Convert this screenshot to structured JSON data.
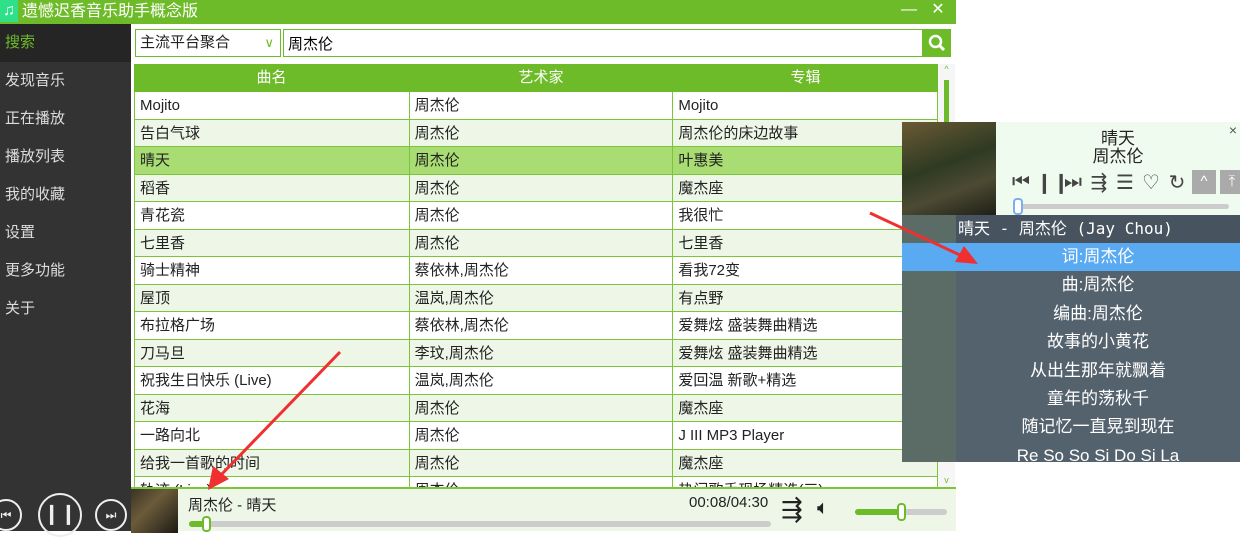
{
  "window": {
    "title": "遗憾迟香音乐助手概念版",
    "minimize": "—",
    "close": "✕",
    "logo_icon": "♫"
  },
  "sidebar": {
    "items": [
      {
        "label": "搜索",
        "active": true
      },
      {
        "label": "发现音乐"
      },
      {
        "label": "正在播放"
      },
      {
        "label": "播放列表"
      },
      {
        "label": "我的收藏"
      },
      {
        "label": "设置"
      },
      {
        "label": "更多功能"
      },
      {
        "label": "关于"
      }
    ]
  },
  "search": {
    "source": "主流平台聚合",
    "query": "周杰伦"
  },
  "table": {
    "headers": [
      "曲名",
      "艺术家",
      "专辑"
    ],
    "selected_index": 2,
    "rows": [
      [
        "Mojito",
        "周杰伦",
        "Mojito"
      ],
      [
        "告白气球",
        "周杰伦",
        "周杰伦的床边故事"
      ],
      [
        "晴天",
        "周杰伦",
        "叶惠美"
      ],
      [
        "稻香",
        "周杰伦",
        "魔杰座"
      ],
      [
        "青花瓷",
        "周杰伦",
        "我很忙"
      ],
      [
        "七里香",
        "周杰伦",
        "七里香"
      ],
      [
        "骑士精神",
        "蔡依林,周杰伦",
        "看我72变"
      ],
      [
        "屋顶",
        "温岚,周杰伦",
        "有点野"
      ],
      [
        "布拉格广场",
        "蔡依林,周杰伦",
        "爱舞炫 盛装舞曲精选"
      ],
      [
        "刀马旦",
        "李玟,周杰伦",
        "爱舞炫 盛装舞曲精选"
      ],
      [
        "祝我生日快乐 (Live)",
        "温岚,周杰伦",
        "爱回温 新歌+精选"
      ],
      [
        "花海",
        "周杰伦",
        "魔杰座"
      ],
      [
        "一路向北",
        "周杰伦",
        "J III MP3 Player"
      ],
      [
        "给我一首歌的时间",
        "周杰伦",
        "魔杰座"
      ],
      [
        "轨迹 (Live)",
        "周杰伦",
        "热门歌手现场精选(三)"
      ]
    ]
  },
  "player": {
    "now_playing": "周杰伦 - 晴天",
    "time": "00:08/04:30",
    "progress": 0.03,
    "volume": 0.5
  },
  "lyrics_window": {
    "title": "晴天",
    "artist": "周杰伦",
    "close": "×",
    "progress": 0.02,
    "header": "晴天 - 周杰伦 (Jay Chou)",
    "current_index": 0,
    "lines": [
      "词:周杰伦",
      "曲:周杰伦",
      "编曲:周杰伦",
      "故事的小黄花",
      "从出生那年就飘着",
      "童年的荡秋千",
      "随记忆一直晃到现在",
      "Re So So Si Do Si La"
    ],
    "controls": {
      "prev": "⏮",
      "pause": "❙❙",
      "next": "⏭",
      "playlist": "⇶",
      "menu": "☰",
      "favorite": "♡",
      "loop": "↻",
      "collapse": "^",
      "pin": "⤒"
    }
  },
  "colors": {
    "accent": "#6dbb29",
    "sidebar": "#333333",
    "lyrics_bg": "#54626e",
    "lyrics_highlight": "#5aaaf2",
    "annotation_arrow": "#f03030"
  }
}
